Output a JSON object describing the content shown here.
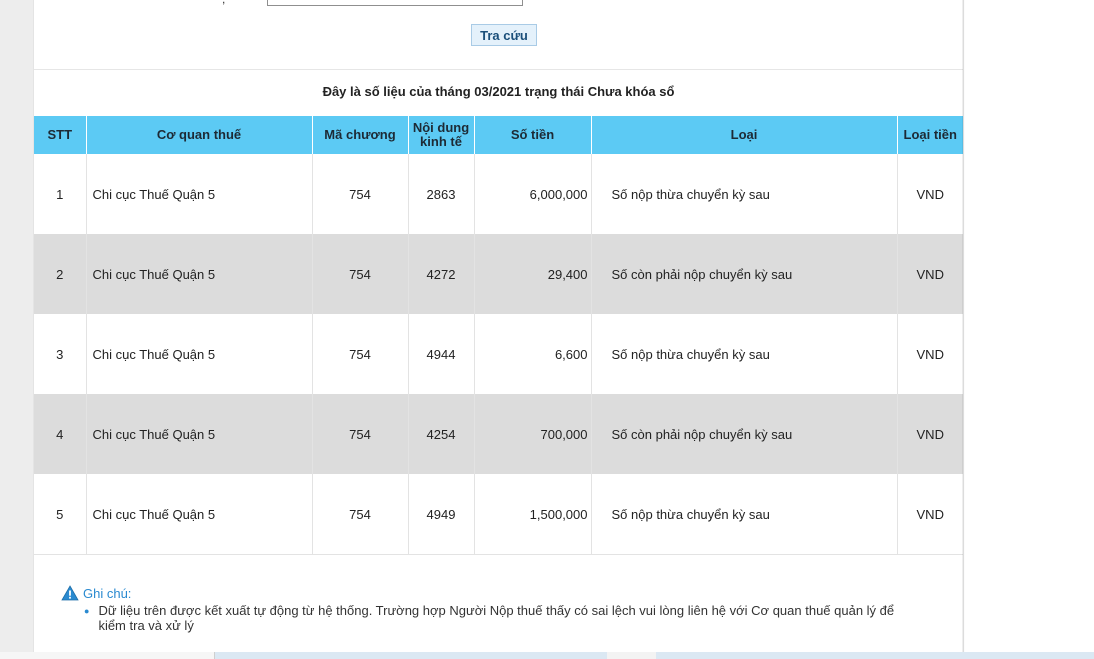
{
  "search": {
    "separator": ",",
    "button_label": "Tra cứu"
  },
  "table_title": "Đây là số liệu của tháng 03/2021 trạng thái Chưa khóa sổ",
  "table": {
    "headers": {
      "stt": "STT",
      "co_quan_thue": "Cơ quan thuế",
      "ma_chuong": "Mã chương",
      "noi_dung_kinh_te_1": "Nội dung",
      "noi_dung_kinh_te_2": "kinh tế",
      "so_tien": "Số tiền",
      "loai": "Loại",
      "loai_tien": "Loại tiền"
    },
    "rows": [
      {
        "stt": "1",
        "co_quan_thue": "Chi cục Thuế Quận 5",
        "ma_chuong": "754",
        "noi_dung": "2863",
        "so_tien": "6,000,000",
        "loai": "Số nộp thừa chuyển kỳ sau",
        "loai_tien": "VND"
      },
      {
        "stt": "2",
        "co_quan_thue": "Chi cục Thuế Quận 5",
        "ma_chuong": "754",
        "noi_dung": "4272",
        "so_tien": "29,400",
        "loai": "Số còn phải nộp chuyển kỳ sau",
        "loai_tien": "VND"
      },
      {
        "stt": "3",
        "co_quan_thue": "Chi cục Thuế Quận 5",
        "ma_chuong": "754",
        "noi_dung": "4944",
        "so_tien": "6,600",
        "loai": "Số nộp thừa chuyển kỳ sau",
        "loai_tien": "VND"
      },
      {
        "stt": "4",
        "co_quan_thue": "Chi cục Thuế Quận 5",
        "ma_chuong": "754",
        "noi_dung": "4254",
        "so_tien": "700,000",
        "loai": "Số còn phải nộp chuyển kỳ sau",
        "loai_tien": "VND"
      },
      {
        "stt": "5",
        "co_quan_thue": "Chi cục Thuế Quận 5",
        "ma_chuong": "754",
        "noi_dung": "4949",
        "so_tien": "1,500,000",
        "loai": "Số nộp thừa chuyển kỳ sau",
        "loai_tien": "VND"
      }
    ]
  },
  "note": {
    "icon": "warning-icon",
    "title": "Ghi chú:",
    "items": [
      "Dữ liệu trên được kết xuất tự động từ hệ thống. Trường hợp Người Nộp thuế thấy có sai lệch vui lòng liên hệ với Cơ quan thuế quản lý để kiểm tra và xử lý"
    ]
  },
  "colors": {
    "header_bg": "#5ccaf4",
    "even_row_bg": "#dcdcdc",
    "note_accent": "#2a8ad0",
    "button_bg": "#e4f1fb"
  }
}
